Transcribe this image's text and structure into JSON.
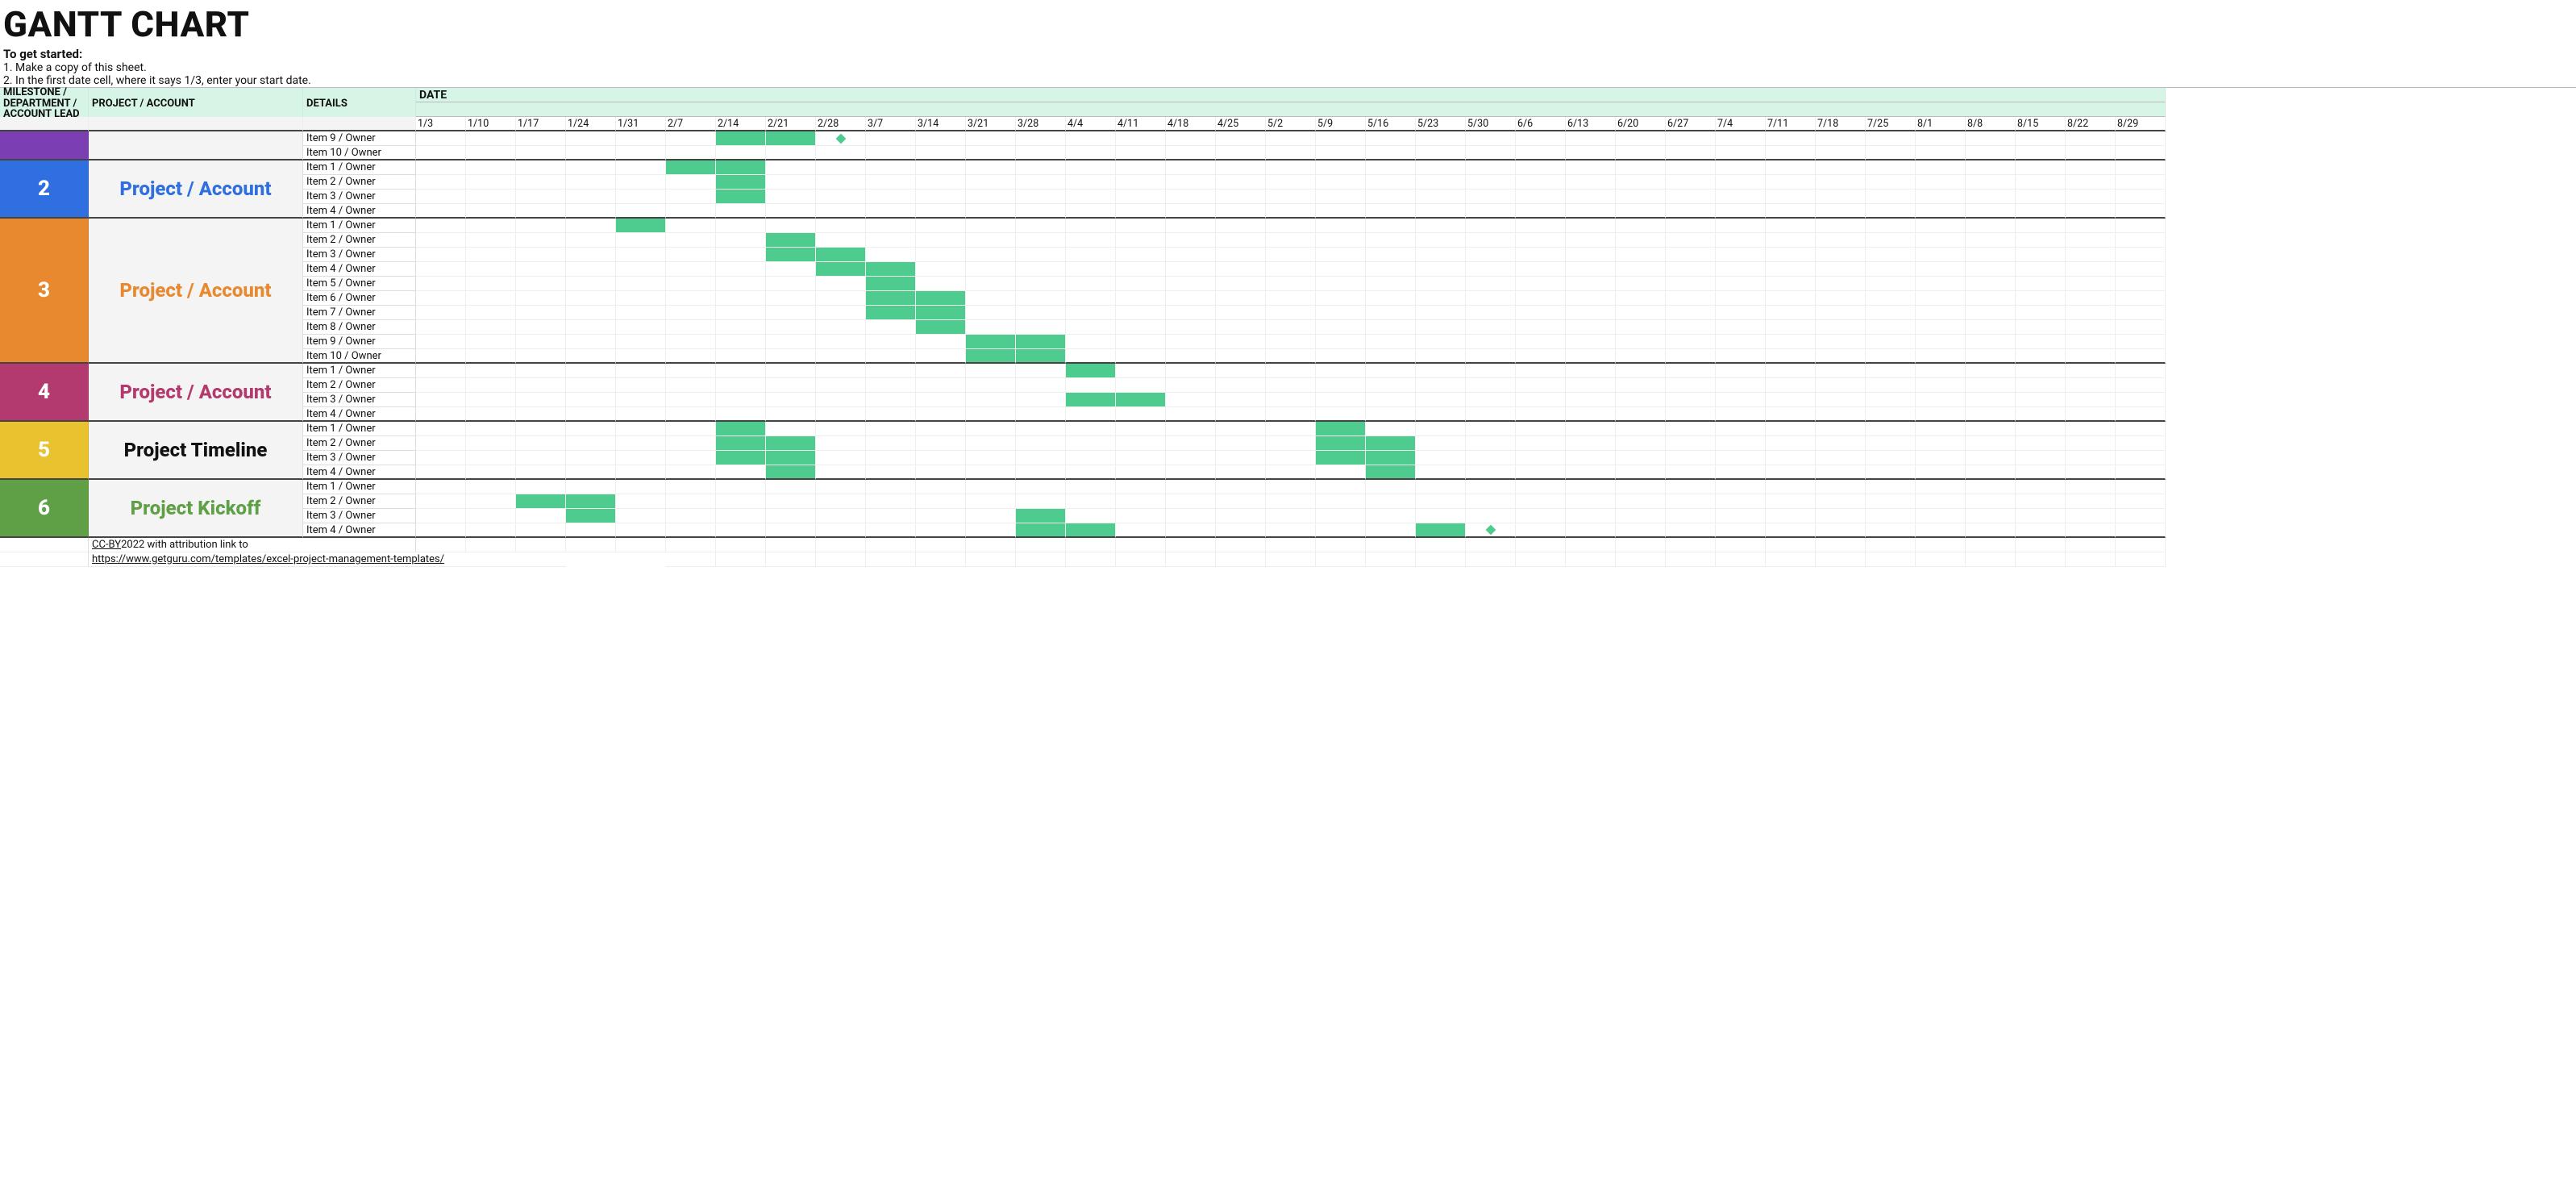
{
  "title": "GANTT CHART",
  "intro": {
    "heading": "To get started:",
    "line1": "1. Make a copy of this sheet.",
    "line2": "2. In the first date cell, where it says 1/3, enter your start date."
  },
  "headers": {
    "milestone": "MILESTONE / DEPARTMENT / ACCOUNT LEAD",
    "project": "PROJECT / ACCOUNT",
    "details": "DETAILS",
    "date": "DATE"
  },
  "dates": [
    "1/3",
    "1/10",
    "1/17",
    "1/24",
    "1/31",
    "2/7",
    "2/14",
    "2/21",
    "2/28",
    "3/7",
    "3/14",
    "3/21",
    "3/28",
    "4/4",
    "4/11",
    "4/18",
    "4/25",
    "5/2",
    "5/9",
    "5/16",
    "5/23",
    "5/30",
    "6/6",
    "6/13",
    "6/20",
    "6/27",
    "7/4",
    "7/11",
    "7/18",
    "7/25",
    "8/1",
    "8/8",
    "8/15",
    "8/22",
    "8/29"
  ],
  "groups": [
    {
      "id": "",
      "id_bg": "#7b3fb3",
      "label": "",
      "label_color": "#7b3fb3",
      "rows": [
        {
          "detail": "Item 9 / Owner",
          "bars": [
            [
              6,
              7
            ]
          ],
          "milestone": 8
        },
        {
          "detail": "Item 10 / Owner",
          "bars": []
        }
      ]
    },
    {
      "id": "2",
      "id_bg": "#2f6fe0",
      "label": "Project / Account",
      "label_color": "#2f6fe0",
      "rows": [
        {
          "detail": "Item 1 / Owner",
          "bars": [
            [
              5,
              6
            ]
          ]
        },
        {
          "detail": "Item 2 / Owner",
          "bars": [
            [
              6,
              6
            ]
          ]
        },
        {
          "detail": "Item 3 / Owner",
          "bars": [
            [
              6,
              6
            ]
          ]
        },
        {
          "detail": "Item 4 / Owner",
          "bars": []
        }
      ]
    },
    {
      "id": "3",
      "id_bg": "#e8892f",
      "label": "Project / Account",
      "label_color": "#e8892f",
      "rows": [
        {
          "detail": "Item 1 / Owner",
          "bars": [
            [
              4,
              4
            ]
          ]
        },
        {
          "detail": "Item 2 / Owner",
          "bars": [
            [
              7,
              7
            ]
          ]
        },
        {
          "detail": "Item 3 / Owner",
          "bars": [
            [
              7,
              8
            ]
          ]
        },
        {
          "detail": "Item 4 / Owner",
          "bars": [
            [
              8,
              9
            ]
          ]
        },
        {
          "detail": "Item 5 / Owner",
          "bars": [
            [
              9,
              9
            ]
          ]
        },
        {
          "detail": "Item 6 / Owner",
          "bars": [
            [
              9,
              10
            ]
          ]
        },
        {
          "detail": "Item 7 / Owner",
          "bars": [
            [
              9,
              10
            ]
          ]
        },
        {
          "detail": "Item 8 / Owner",
          "bars": [
            [
              10,
              10
            ]
          ]
        },
        {
          "detail": "Item 9 / Owner",
          "bars": [
            [
              11,
              12
            ]
          ]
        },
        {
          "detail": "Item 10 / Owner",
          "bars": [
            [
              11,
              12
            ]
          ]
        }
      ]
    },
    {
      "id": "4",
      "id_bg": "#b33a6f",
      "label": "Project / Account",
      "label_color": "#b33a6f",
      "rows": [
        {
          "detail": "Item 1 / Owner",
          "bars": [
            [
              13,
              13
            ]
          ]
        },
        {
          "detail": "Item 2 / Owner",
          "bars": []
        },
        {
          "detail": "Item 3 / Owner",
          "bars": [
            [
              13,
              14
            ]
          ]
        },
        {
          "detail": "Item 4 / Owner",
          "bars": []
        }
      ]
    },
    {
      "id": "5",
      "id_bg": "#e8c22f",
      "label": "Project Timeline",
      "label_color": "#111",
      "rows": [
        {
          "detail": "Item 1 / Owner",
          "bars": [
            [
              6,
              6
            ],
            [
              18,
              18
            ]
          ]
        },
        {
          "detail": "Item 2 / Owner",
          "bars": [
            [
              6,
              7
            ],
            [
              18,
              19
            ]
          ]
        },
        {
          "detail": "Item 3 / Owner",
          "bars": [
            [
              6,
              7
            ],
            [
              18,
              19
            ]
          ]
        },
        {
          "detail": "Item 4 / Owner",
          "bars": [
            [
              7,
              7
            ],
            [
              19,
              19
            ]
          ]
        }
      ]
    },
    {
      "id": "6",
      "id_bg": "#5fa046",
      "label": "Project Kickoff",
      "label_color": "#5fa046",
      "rows": [
        {
          "detail": "Item 1 / Owner",
          "bars": []
        },
        {
          "detail": "Item 2 / Owner",
          "bars": [
            [
              2,
              3
            ]
          ]
        },
        {
          "detail": "Item 3 / Owner",
          "bars": [
            [
              3,
              3
            ],
            [
              12,
              12
            ]
          ]
        },
        {
          "detail": "Item 4 / Owner",
          "bars": [
            [
              12,
              13
            ],
            [
              20,
              20
            ]
          ],
          "milestone": 21
        }
      ]
    }
  ],
  "footer": {
    "license_prefix": "CC-BY",
    "license_suffix": " 2022 with attribution link to",
    "url": "https://www.getguru.com/templates/excel-project-management-templates/"
  },
  "chart_data": {
    "type": "bar",
    "title": "GANTT CHART",
    "x_categories": [
      "1/3",
      "1/10",
      "1/17",
      "1/24",
      "1/31",
      "2/7",
      "2/14",
      "2/21",
      "2/28",
      "3/7",
      "3/14",
      "3/21",
      "3/28",
      "4/4",
      "4/11",
      "4/18",
      "4/25",
      "5/2",
      "5/9",
      "5/16",
      "5/23",
      "5/30",
      "6/6",
      "6/13",
      "6/20",
      "6/27",
      "7/4",
      "7/11",
      "7/18",
      "7/25",
      "8/1",
      "8/8",
      "8/15",
      "8/22",
      "8/29"
    ],
    "series": [
      {
        "group": "1 (purple)",
        "name": "Item 9 / Owner",
        "segments": [
          [
            "2/14",
            "2/21"
          ]
        ],
        "milestone": "2/28"
      },
      {
        "group": "1 (purple)",
        "name": "Item 10 / Owner",
        "segments": []
      },
      {
        "group": "2",
        "name": "Item 1 / Owner",
        "segments": [
          [
            "2/7",
            "2/14"
          ]
        ]
      },
      {
        "group": "2",
        "name": "Item 2 / Owner",
        "segments": [
          [
            "2/14",
            "2/14"
          ]
        ]
      },
      {
        "group": "2",
        "name": "Item 3 / Owner",
        "segments": [
          [
            "2/14",
            "2/14"
          ]
        ]
      },
      {
        "group": "2",
        "name": "Item 4 / Owner",
        "segments": []
      },
      {
        "group": "3",
        "name": "Item 1 / Owner",
        "segments": [
          [
            "1/31",
            "1/31"
          ]
        ]
      },
      {
        "group": "3",
        "name": "Item 2 / Owner",
        "segments": [
          [
            "2/21",
            "2/21"
          ]
        ]
      },
      {
        "group": "3",
        "name": "Item 3 / Owner",
        "segments": [
          [
            "2/21",
            "2/28"
          ]
        ]
      },
      {
        "group": "3",
        "name": "Item 4 / Owner",
        "segments": [
          [
            "2/28",
            "3/7"
          ]
        ]
      },
      {
        "group": "3",
        "name": "Item 5 / Owner",
        "segments": [
          [
            "3/7",
            "3/7"
          ]
        ]
      },
      {
        "group": "3",
        "name": "Item 6 / Owner",
        "segments": [
          [
            "3/7",
            "3/14"
          ]
        ]
      },
      {
        "group": "3",
        "name": "Item 7 / Owner",
        "segments": [
          [
            "3/7",
            "3/14"
          ]
        ]
      },
      {
        "group": "3",
        "name": "Item 8 / Owner",
        "segments": [
          [
            "3/14",
            "3/14"
          ]
        ]
      },
      {
        "group": "3",
        "name": "Item 9 / Owner",
        "segments": [
          [
            "3/21",
            "3/28"
          ]
        ]
      },
      {
        "group": "3",
        "name": "Item 10 / Owner",
        "segments": [
          [
            "3/21",
            "3/28"
          ]
        ]
      },
      {
        "group": "4",
        "name": "Item 1 / Owner",
        "segments": [
          [
            "4/4",
            "4/4"
          ]
        ]
      },
      {
        "group": "4",
        "name": "Item 2 / Owner",
        "segments": []
      },
      {
        "group": "4",
        "name": "Item 3 / Owner",
        "segments": [
          [
            "4/4",
            "4/11"
          ]
        ]
      },
      {
        "group": "4",
        "name": "Item 4 / Owner",
        "segments": []
      },
      {
        "group": "5",
        "name": "Item 1 / Owner",
        "segments": [
          [
            "2/14",
            "2/14"
          ],
          [
            "5/9",
            "5/9"
          ]
        ]
      },
      {
        "group": "5",
        "name": "Item 2 / Owner",
        "segments": [
          [
            "2/14",
            "2/21"
          ],
          [
            "5/9",
            "5/16"
          ]
        ]
      },
      {
        "group": "5",
        "name": "Item 3 / Owner",
        "segments": [
          [
            "2/14",
            "2/21"
          ],
          [
            "5/9",
            "5/16"
          ]
        ]
      },
      {
        "group": "5",
        "name": "Item 4 / Owner",
        "segments": [
          [
            "2/21",
            "2/21"
          ],
          [
            "5/16",
            "5/16"
          ]
        ]
      },
      {
        "group": "6",
        "name": "Item 1 / Owner",
        "segments": []
      },
      {
        "group": "6",
        "name": "Item 2 / Owner",
        "segments": [
          [
            "1/17",
            "1/24"
          ]
        ]
      },
      {
        "group": "6",
        "name": "Item 3 / Owner",
        "segments": [
          [
            "1/24",
            "1/24"
          ],
          [
            "3/28",
            "3/28"
          ]
        ]
      },
      {
        "group": "6",
        "name": "Item 4 / Owner",
        "segments": [
          [
            "3/28",
            "4/4"
          ],
          [
            "5/23",
            "5/23"
          ]
        ],
        "milestone": "5/30"
      }
    ],
    "xlabel": "DATE",
    "ylabel": "DETAILS"
  }
}
